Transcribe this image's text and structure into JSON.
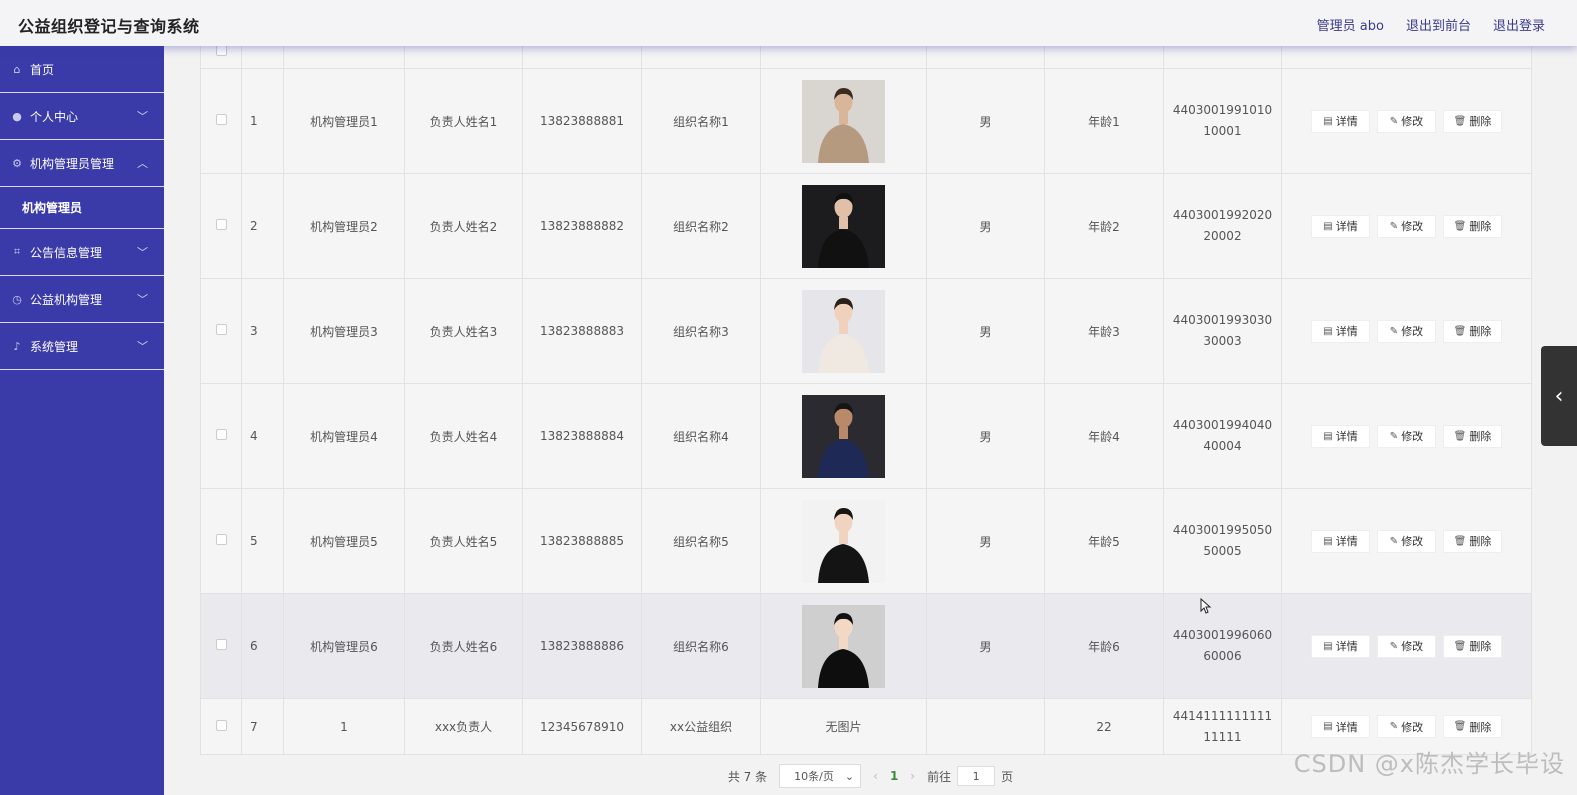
{
  "header": {
    "title": "公益组织登记与查询系统",
    "admin_label": "管理员 abo",
    "back_front": "退出到前台",
    "logout": "退出登录"
  },
  "sidebar": {
    "items": [
      {
        "label": "首页",
        "icon": "home-icon"
      },
      {
        "label": "个人中心",
        "icon": "user-icon"
      },
      {
        "label": "机构管理员管理",
        "icon": "settings-icon"
      },
      {
        "label": "公告信息管理",
        "icon": "crop-icon"
      },
      {
        "label": "公益机构管理",
        "icon": "clock-icon"
      },
      {
        "label": "系统管理",
        "icon": "mic-icon"
      }
    ],
    "sub_item": "机构管理员"
  },
  "table": {
    "rows": [
      {
        "index": "1",
        "account": "机构管理员1",
        "leader": "负责人姓名1",
        "phone": "13823888881",
        "org": "组织名称1",
        "photo": "photo",
        "gender": "男",
        "age": "年龄1",
        "idno": "440300199101010001"
      },
      {
        "index": "2",
        "account": "机构管理员2",
        "leader": "负责人姓名2",
        "phone": "13823888882",
        "org": "组织名称2",
        "photo": "photo",
        "gender": "男",
        "age": "年龄2",
        "idno": "440300199202020002"
      },
      {
        "index": "3",
        "account": "机构管理员3",
        "leader": "负责人姓名3",
        "phone": "13823888883",
        "org": "组织名称3",
        "photo": "photo",
        "gender": "男",
        "age": "年龄3",
        "idno": "440300199303030003"
      },
      {
        "index": "4",
        "account": "机构管理员4",
        "leader": "负责人姓名4",
        "phone": "13823888884",
        "org": "组织名称4",
        "photo": "photo",
        "gender": "男",
        "age": "年龄4",
        "idno": "440300199404040004"
      },
      {
        "index": "5",
        "account": "机构管理员5",
        "leader": "负责人姓名5",
        "phone": "13823888885",
        "org": "组织名称5",
        "photo": "photo",
        "gender": "男",
        "age": "年龄5",
        "idno": "440300199505050005"
      },
      {
        "index": "6",
        "account": "机构管理员6",
        "leader": "负责人姓名6",
        "phone": "13823888886",
        "org": "组织名称6",
        "photo": "photo",
        "gender": "男",
        "age": "年龄6",
        "idno": "440300199606060006"
      },
      {
        "index": "7",
        "account": "1",
        "leader": "xxx负责人",
        "phone": "12345678910",
        "org": "xx公益组织",
        "photo": "无图片",
        "gender": "",
        "age": "22",
        "idno": "441411111111111111"
      }
    ],
    "actions": {
      "detail": "详情",
      "edit": "修改",
      "delete": "删除"
    }
  },
  "pagination": {
    "total": "共 7 条",
    "page_size": "10条/页",
    "current": "1",
    "goto_label": "前往",
    "goto_value": "1",
    "page_suffix": "页"
  },
  "watermark": "CSDN @x陈杰学长毕设",
  "colors": {
    "sidebar": "#3a3aa8",
    "accent": "#3a3a8c"
  }
}
